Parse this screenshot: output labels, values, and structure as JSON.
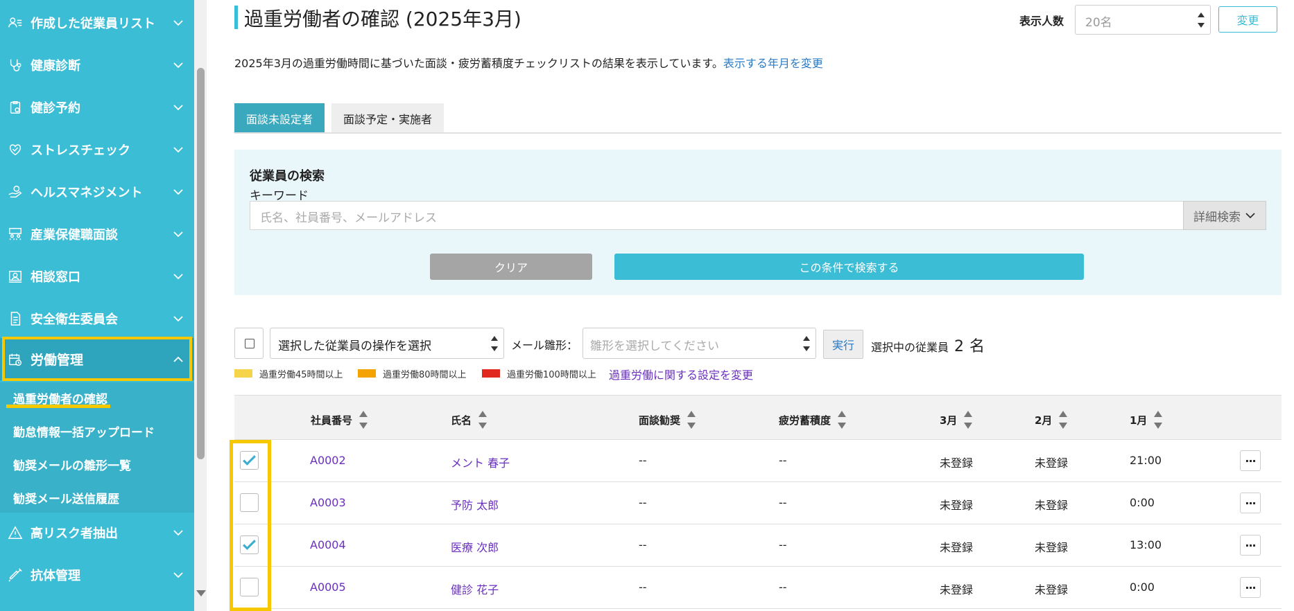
{
  "sidebar": {
    "items": [
      {
        "label": "作成した従業員リスト",
        "icon": "employee-list-icon"
      },
      {
        "label": "健康診断",
        "icon": "stethoscope-icon"
      },
      {
        "label": "健診予約",
        "icon": "clipboard-check-icon"
      },
      {
        "label": "ストレスチェック",
        "icon": "heart-check-icon"
      },
      {
        "label": "ヘルスマネジメント",
        "icon": "hand-care-icon"
      },
      {
        "label": "産業保健職面談",
        "icon": "interview-icon"
      },
      {
        "label": "相談窓口",
        "icon": "consult-icon"
      },
      {
        "label": "安全衛生委員会",
        "icon": "document-icon"
      },
      {
        "label": "労働管理",
        "icon": "calendar-clock-icon",
        "active": true
      },
      {
        "label": "高リスク者抽出",
        "icon": "warning-icon"
      },
      {
        "label": "抗体管理",
        "icon": "syringe-icon"
      }
    ],
    "subitems": [
      {
        "label": "過重労働者の確認",
        "active": true
      },
      {
        "label": "勤怠情報一括アップロード"
      },
      {
        "label": "勧奨メールの雛形一覧"
      },
      {
        "label": "勧奨メール送信履歴"
      }
    ]
  },
  "header": {
    "title": "過重労働者の確認 (2025年3月)",
    "count_label": "表示人数",
    "count_value": "20名",
    "change_label": "変更",
    "description": "2025年3月の過重労働時間に基づいた面談・疲労蓄積度チェックリストの結果を表示しています。",
    "change_month_link": "表示する年月を変更"
  },
  "tabs": [
    {
      "label": "面談未設定者",
      "active": true
    },
    {
      "label": "面談予定・実施者",
      "active": false
    }
  ],
  "search": {
    "title": "従業員の検索",
    "keyword_label": "キーワード",
    "placeholder": "氏名、社員番号、メールアドレス",
    "advanced_label": "詳細検索",
    "clear_label": "クリア",
    "submit_label": "この条件で検索する"
  },
  "actions": {
    "operation_placeholder": "選択した従業員の操作を選択",
    "mail_template_label": "メール雛形：",
    "mail_template_placeholder": "雛形を選択してください",
    "execute_label": "実行",
    "selected_label": "選択中の従業員",
    "selected_count": "2",
    "selected_unit": "名"
  },
  "legend": [
    {
      "label": "過重労働45時間以上",
      "color": "#f5d44a"
    },
    {
      "label": "過重労働80時間以上",
      "color": "#f5a300"
    },
    {
      "label": "過重労働100時間以上",
      "color": "#e02a1f"
    }
  ],
  "legend_link": "過重労働に関する設定を変更",
  "table": {
    "columns": [
      "社員番号",
      "氏名",
      "面談勧奨",
      "疲労蓄積度",
      "3月",
      "2月",
      "1月"
    ],
    "rows": [
      {
        "checked": true,
        "id": "A0002",
        "name": "メント 春子",
        "recommend": "--",
        "fatigue": "--",
        "mar": "未登録",
        "feb": "未登録",
        "jan": "21:00",
        "more": "···"
      },
      {
        "checked": false,
        "id": "A0003",
        "name": "予防 太郎",
        "recommend": "--",
        "fatigue": "--",
        "mar": "未登録",
        "feb": "未登録",
        "jan": "0:00",
        "more": "···"
      },
      {
        "checked": true,
        "id": "A0004",
        "name": "医療 次郎",
        "recommend": "--",
        "fatigue": "--",
        "mar": "未登録",
        "feb": "未登録",
        "jan": "13:00",
        "more": "···"
      },
      {
        "checked": false,
        "id": "A0005",
        "name": "健診 花子",
        "recommend": "--",
        "fatigue": "--",
        "mar": "未登録",
        "feb": "未登録",
        "jan": "0:00",
        "more": "···"
      }
    ]
  },
  "colors": {
    "sidebar": "#3cbdd6",
    "accent": "#3cbdd6",
    "highlight": "#f5c800",
    "link": "#6a2fbf"
  }
}
